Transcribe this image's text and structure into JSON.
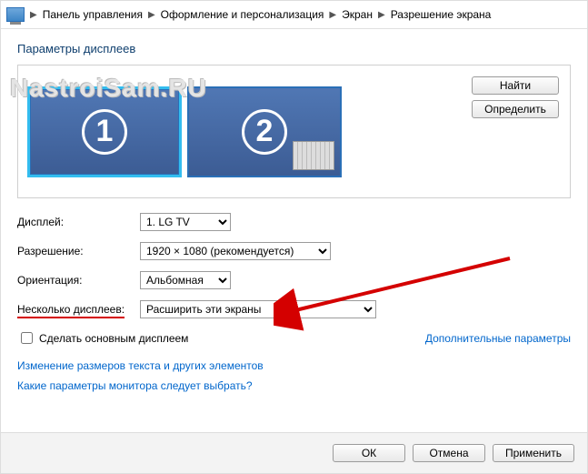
{
  "breadcrumb": {
    "items": [
      "Панель управления",
      "Оформление и персонализация",
      "Экран",
      "Разрешение экрана"
    ]
  },
  "watermark": "NastroiSam.RU",
  "title": "Параметры дисплеев",
  "preview": {
    "find_btn": "Найти",
    "detect_btn": "Определить",
    "mon1_num": "1",
    "mon2_num": "2"
  },
  "fields": {
    "display_label": "Дисплей:",
    "display_value": "1. LG TV",
    "resolution_label": "Разрешение:",
    "resolution_value": "1920 × 1080 (рекомендуется)",
    "orientation_label": "Ориентация:",
    "orientation_value": "Альбомная",
    "multi_label": "Несколько дисплеев:",
    "multi_value": "Расширить эти экраны"
  },
  "checkbox": {
    "label": "Сделать основным дисплеем"
  },
  "advanced_link": "Дополнительные параметры",
  "links": {
    "text_size": "Изменение размеров текста и других элементов",
    "which_monitor": "Какие параметры монитора следует выбрать?"
  },
  "buttons": {
    "ok": "ОК",
    "cancel": "Отмена",
    "apply": "Применить"
  }
}
